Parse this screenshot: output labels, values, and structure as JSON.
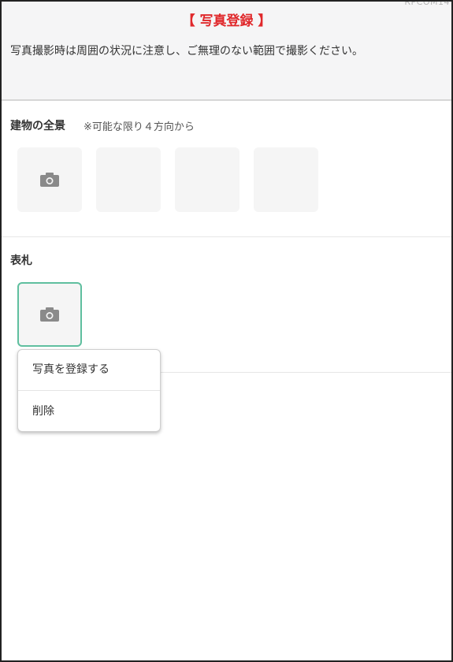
{
  "screen_id": "RPCOM14",
  "header": {
    "title": "【 写真登録 】",
    "notice": "写真撮影時は周囲の状況に注意し、ご無理のない範囲で撮影ください。"
  },
  "sections": [
    {
      "title": "建物の全景",
      "note": "※可能な限り４方向から",
      "slots": [
        {
          "icon": "camera-icon"
        },
        {
          "icon": ""
        },
        {
          "icon": ""
        },
        {
          "icon": ""
        }
      ]
    },
    {
      "title": "表札",
      "note": "",
      "slots": [
        {
          "icon": "camera-icon",
          "selected": true
        }
      ]
    }
  ],
  "menu": {
    "items": [
      {
        "label": "写真を登録する"
      },
      {
        "label": "削除"
      }
    ]
  },
  "colors": {
    "title": "#e0282b",
    "selected_border": "#5fbf9f",
    "tile_bg": "#f5f5f5"
  }
}
